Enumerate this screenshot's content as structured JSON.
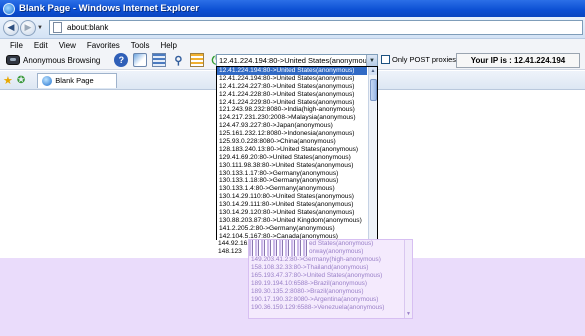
{
  "window": {
    "title": "Blank Page - Windows Internet Explorer"
  },
  "address": {
    "url": "about:blank"
  },
  "menu": [
    "File",
    "Edit",
    "View",
    "Favorites",
    "Tools",
    "Help"
  ],
  "toolbar": {
    "anon_label": "Anonymous Browsing",
    "selected_proxy": "12.41.224.194:80->United States(anonymous)",
    "post_label": "Only POST proxies",
    "ip_label": "Your IP is : 12.41.224.194"
  },
  "tab": {
    "label": "Blank Page"
  },
  "proxy_list": [
    "12.41.224.194:80->United States(anonymous)",
    "12.41.224.227:80->United States(anonymous)",
    "12.41.224.228:80->United States(anonymous)",
    "12.41.224.229:80->United States(anonymous)",
    "121.243.98.232:8080->India(high-anonymous)",
    "124.217.231.230:2008->Malaysia(anonymous)",
    "124.47.93.227:80->Japan(anonymous)",
    "125.161.232.12:8080->Indonesia(anonymous)",
    "125.93.0.228:8080->China(anonymous)",
    "128.183.240.13:80->United States(anonymous)",
    "129.41.69.20:80->United States(anonymous)",
    "130.111.98.38:80->United States(anonymous)",
    "130.133.1.17:80->Germany(anonymous)",
    "130.133.1.18:80->Germany(anonymous)",
    "130.133.1.4:80->Germany(anonymous)",
    "130.14.29.110:80->United States(anonymous)",
    "130.14.29.111:80->United States(anonymous)",
    "130.14.29.120:80->United States(anonymous)",
    "130.88.203.87:80->United Kingdom(anonymous)",
    "141.2.205.2:80->Germany(anonymous)",
    "142.104.5.167:80->Canada(anonymous)"
  ],
  "partial_rows": [
    "144.92.161",
    "148.123"
  ],
  "glitch_list": [
    "ed States(anonymous)",
    "orway(anonymous)",
    "149.203.41.2:80->Germany(high-anonymous)",
    "158.108.32.33:80->Thailand(anonymous)",
    "165.193.47.37:80->United States(anonymous)",
    "189.19.194.10:6588->Brazil(anonymous)",
    "189.30.135.2:8080->Brazil(anonymous)",
    "190.17.190.32:8080->Argentina(anonymous)",
    "190.36.159.129:6588->Venezuela(anonymous)"
  ]
}
